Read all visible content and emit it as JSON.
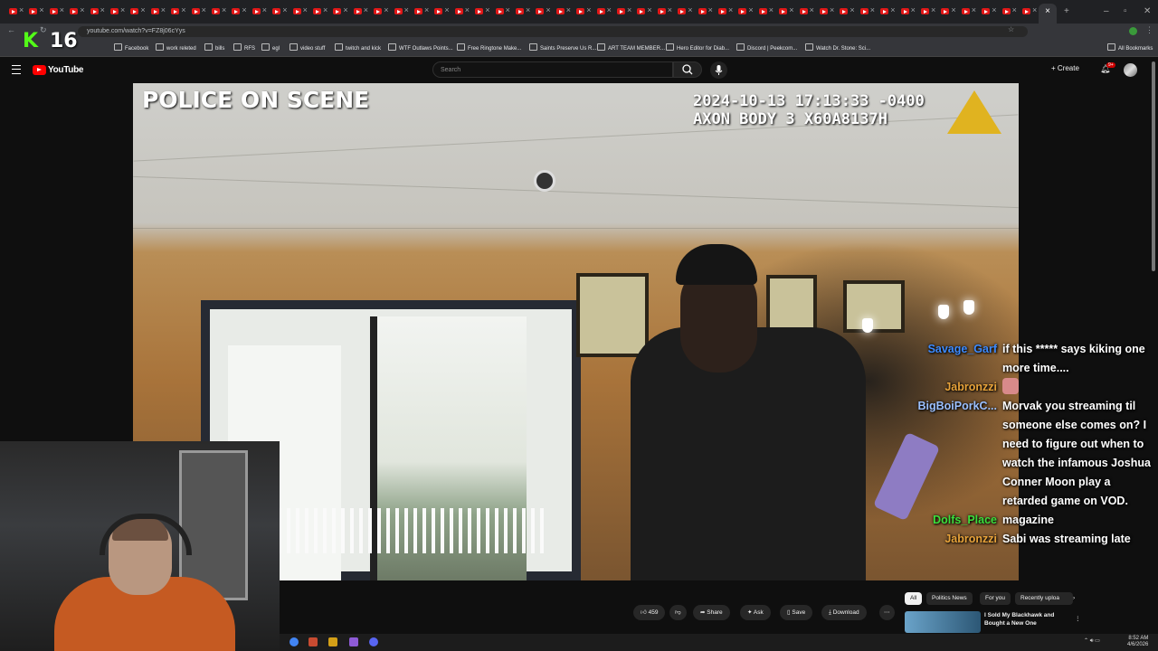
{
  "browser": {
    "url": "youtube.com/watch?v=FZ8j06cYys",
    "bookmarks": [
      "Facebook",
      "work releted",
      "bills",
      "RFS",
      "egl",
      "video stuff",
      "twitch and kick",
      "WTF Outlaws Points...",
      "Free Ringtone Make...",
      "Saints Preserve Us R...",
      "ART TEAM MEMBER...",
      "Hero Editor for Diab...",
      "Discord | Peekcom...",
      "Watch Dr. Stone: Sci..."
    ],
    "all_bookmarks": "All Bookmarks",
    "active_tab_close": "×"
  },
  "stream_overlay": {
    "logo": "K",
    "viewer_count": "16"
  },
  "youtube": {
    "logo_text": "YouTube",
    "search_placeholder": "Search",
    "create_label": "Create",
    "notification_badge": "9+"
  },
  "video": {
    "overlay_title": "POLICE ON SCENE",
    "timestamp": "2024-10-13 17:13:33 -0400",
    "device": "AXON BODY 3 X60A8137H"
  },
  "chat": {
    "messages": [
      {
        "user": "Savage_Garf",
        "color": "#3d8bff",
        "text": "if this ***** says kiking one more time...."
      },
      {
        "user": "Jabronzzi",
        "color": "#e8a33a",
        "text": "",
        "emote": true
      },
      {
        "user": "BigBoiPorkC...",
        "color": "#9bc0ff",
        "text": "Morvak you streaming til someone else comes on? I need to figure out when to watch the infamous Joshua Conner Moon play a retarded game on VOD."
      },
      {
        "user": "Dolfs_Place",
        "color": "#3cde3c",
        "text": "magazine"
      },
      {
        "user": "Jabronzzi",
        "color": "#e8a33a",
        "text": "Sabi was streaming late"
      }
    ]
  },
  "actions": {
    "likes": "459",
    "share": "Share",
    "ask": "Ask",
    "save": "Save",
    "download": "Download"
  },
  "recommended": {
    "chips": [
      "All",
      "Politics News",
      "For you",
      "Recently uploa"
    ],
    "video_title": "I Sold My Blackhawk and Bought a New One"
  },
  "system": {
    "time": "8:52 AM",
    "date": "4/6/2026"
  }
}
